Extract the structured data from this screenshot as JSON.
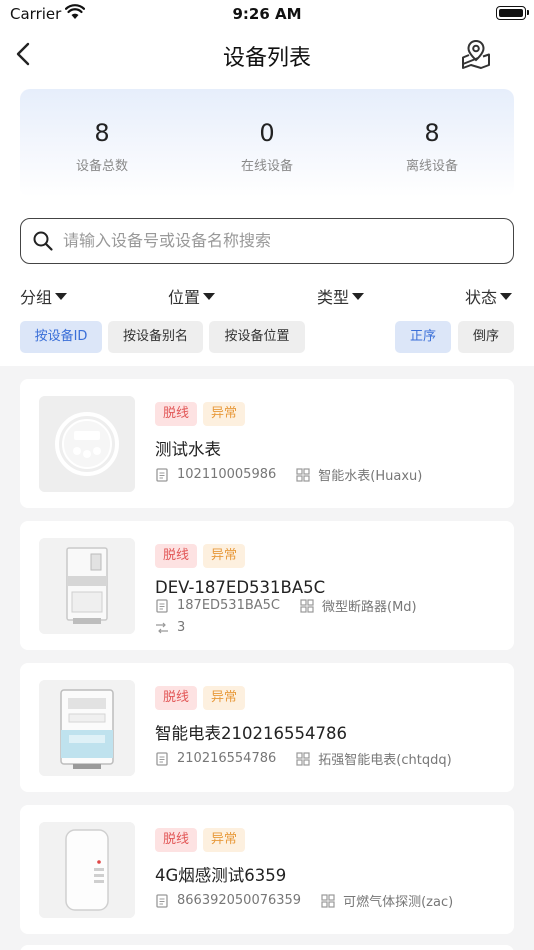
{
  "status_bar": {
    "carrier": "Carrier",
    "time": "9:26 AM"
  },
  "nav": {
    "title": "设备列表"
  },
  "stats": [
    {
      "value": "8",
      "label": "设备总数"
    },
    {
      "value": "0",
      "label": "在线设备"
    },
    {
      "value": "8",
      "label": "离线设备"
    }
  ],
  "search": {
    "placeholder": "请输入设备号或设备名称搜索",
    "value": ""
  },
  "filters": [
    "分组",
    "位置",
    "类型",
    "状态"
  ],
  "sort_by": [
    {
      "label": "按设备ID",
      "active": true
    },
    {
      "label": "按设备别名",
      "active": false
    },
    {
      "label": "按设备位置",
      "active": false
    }
  ],
  "order": [
    {
      "label": "正序",
      "active": true
    },
    {
      "label": "倒序",
      "active": false
    }
  ],
  "devices": [
    {
      "status": "脱线",
      "alarm": "异常",
      "name": "测试水表",
      "serial": "102110005986",
      "model": "智能水表(Huaxu)",
      "icon": "water-meter-image"
    },
    {
      "status": "脱线",
      "alarm": "异常",
      "name": "DEV-187ED531BA5C",
      "serial": "187ED531BA5C",
      "model": "微型断路器(Md)",
      "channels": "3",
      "icon": "circuit-breaker-image"
    },
    {
      "status": "脱线",
      "alarm": "异常",
      "name": "智能电表210216554786",
      "serial": "210216554786",
      "model": "拓强智能电表(chtqdq)",
      "icon": "electric-meter-image"
    },
    {
      "status": "脱线",
      "alarm": "异常",
      "name": "4G烟感测试6359",
      "serial": "866392050076359",
      "model": "可燃气体探测(zac)",
      "icon": "smoke-detector-image"
    }
  ],
  "colors": {
    "accent": "#3a6fd8",
    "offline": "#e25757",
    "warning": "#e89a3c"
  }
}
